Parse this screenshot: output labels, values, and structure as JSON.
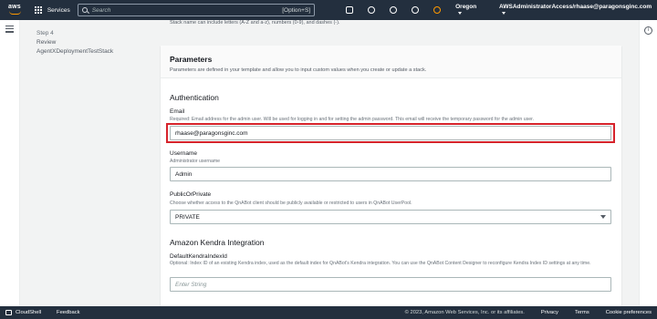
{
  "topbar": {
    "logo": "aws",
    "services_label": "Services",
    "search_placeholder": "Search",
    "search_shortcut": "[Option+S]",
    "region": "Oregon",
    "account": "AWSAdministratorAccess/rhaase@paragonsginc.com"
  },
  "steps": {
    "step_number": "Step 4",
    "step_title": "Review",
    "stack_name": "AgentXDeploymentTestStack"
  },
  "stack_name_note": "Stack name can include letters (A-Z and a-z), numbers (0-9), and dashes (-).",
  "parameters": {
    "title": "Parameters",
    "description": "Parameters are defined in your template and allow you to input custom values when you create or update a stack."
  },
  "authentication": {
    "title": "Authentication",
    "email": {
      "label": "Email",
      "description": "Required: Email address for the admin user. Will be used for logging in and for setting the admin password. This email will receive the temporary password for the admin user.",
      "value": "rhaase@paragonsginc.com"
    },
    "username": {
      "label": "Username",
      "description": "Administrator username",
      "value": "Admin"
    },
    "public_or_private": {
      "label": "PublicOrPrivate",
      "description": "Choose whether access to the QnABot client should be publicly available or restricted to users in QnABot UserPool.",
      "value": "PRIVATE"
    }
  },
  "kendra": {
    "title": "Amazon Kendra Integration",
    "index": {
      "label": "DefaultKendraIndexId",
      "description": "Optional: Index ID of an existing Kendra index, used as the default index for QnABot's Kendra integration. You can use the QnABot Content Designer to reconfigure Kendra Index ID settings at any time.",
      "placeholder": "Enter String"
    }
  },
  "footer": {
    "cloudshell": "CloudShell",
    "feedback": "Feedback",
    "copyright": "© 2023, Amazon Web Services, Inc. or its affiliates.",
    "privacy": "Privacy",
    "terms": "Terms",
    "cookies": "Cookie preferences"
  },
  "colors": {
    "nav_bg": "#232f3e",
    "highlight": "#d6232b",
    "accent": "#ff9900"
  }
}
